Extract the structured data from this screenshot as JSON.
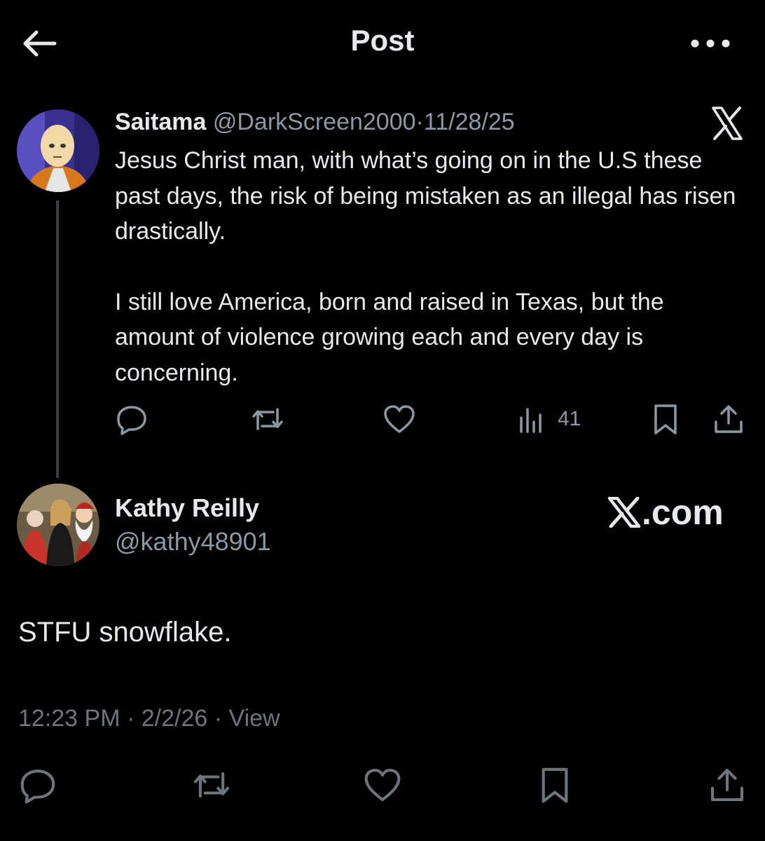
{
  "header": {
    "back_icon": "arrow-left-icon",
    "title": "Post",
    "more_icon": "more-horizontal-icon"
  },
  "parent_post": {
    "author_name": "Saitama",
    "handle": "@DarkScreen2000",
    "separator": "·",
    "date": "11/28/25",
    "brand_icon": "x-logo-icon",
    "paragraphs": [
      "Jesus Christ man, with what’s going on in the U.S these past days, the risk of being mistaken as an illegal has risen drastically.",
      "I still love America, born and raised in Texas, but the amount of violence growing each and every day is concerning."
    ],
    "actions": {
      "reply_icon": "reply-icon",
      "repost_icon": "repost-icon",
      "like_icon": "like-icon",
      "views_icon": "views-icon",
      "views_count": "41",
      "bookmark_icon": "bookmark-icon",
      "share_icon": "share-icon"
    }
  },
  "reply_post": {
    "author_name": "Kathy Reilly",
    "handle": "@kathy48901",
    "watermark": ".com",
    "text": "STFU snowflake.",
    "time": "12:23 PM",
    "separator": "·",
    "date": "2/2/26",
    "views_label": "View",
    "actions": {
      "reply_icon": "reply-icon",
      "repost_icon": "repost-icon",
      "like_icon": "like-icon",
      "bookmark_icon": "bookmark-icon",
      "share_icon": "share-icon"
    }
  },
  "colors": {
    "background": "#000000",
    "primary_text": "#e7e9ea",
    "secondary_text": "#8b98a5",
    "thread_line": "#3a3f44"
  }
}
